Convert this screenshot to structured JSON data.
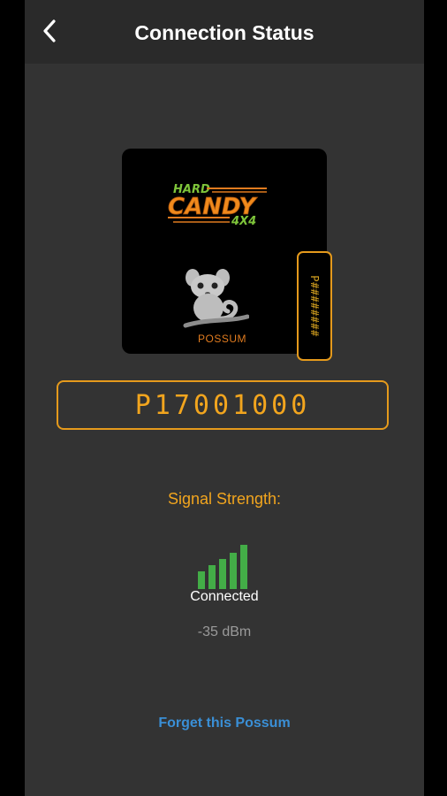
{
  "header": {
    "title": "Connection Status",
    "back_icon": "chevron-left-icon"
  },
  "device": {
    "logo_icon": "hard-candy-4x4-logo",
    "brand": "POSSUM",
    "side_tag": "P########",
    "possum_icon": "possum-icon"
  },
  "serial": "P17001000",
  "signal": {
    "label": "Signal Strength:",
    "bars_filled": 5,
    "bars_total": 5,
    "status": "Connected",
    "dbm": "-35 dBm"
  },
  "actions": {
    "forget": "Forget this Possum"
  },
  "colors": {
    "accent": "#f2a51e",
    "signal_green": "#43ad47",
    "link": "#3a8fd6",
    "background": "#333333"
  }
}
